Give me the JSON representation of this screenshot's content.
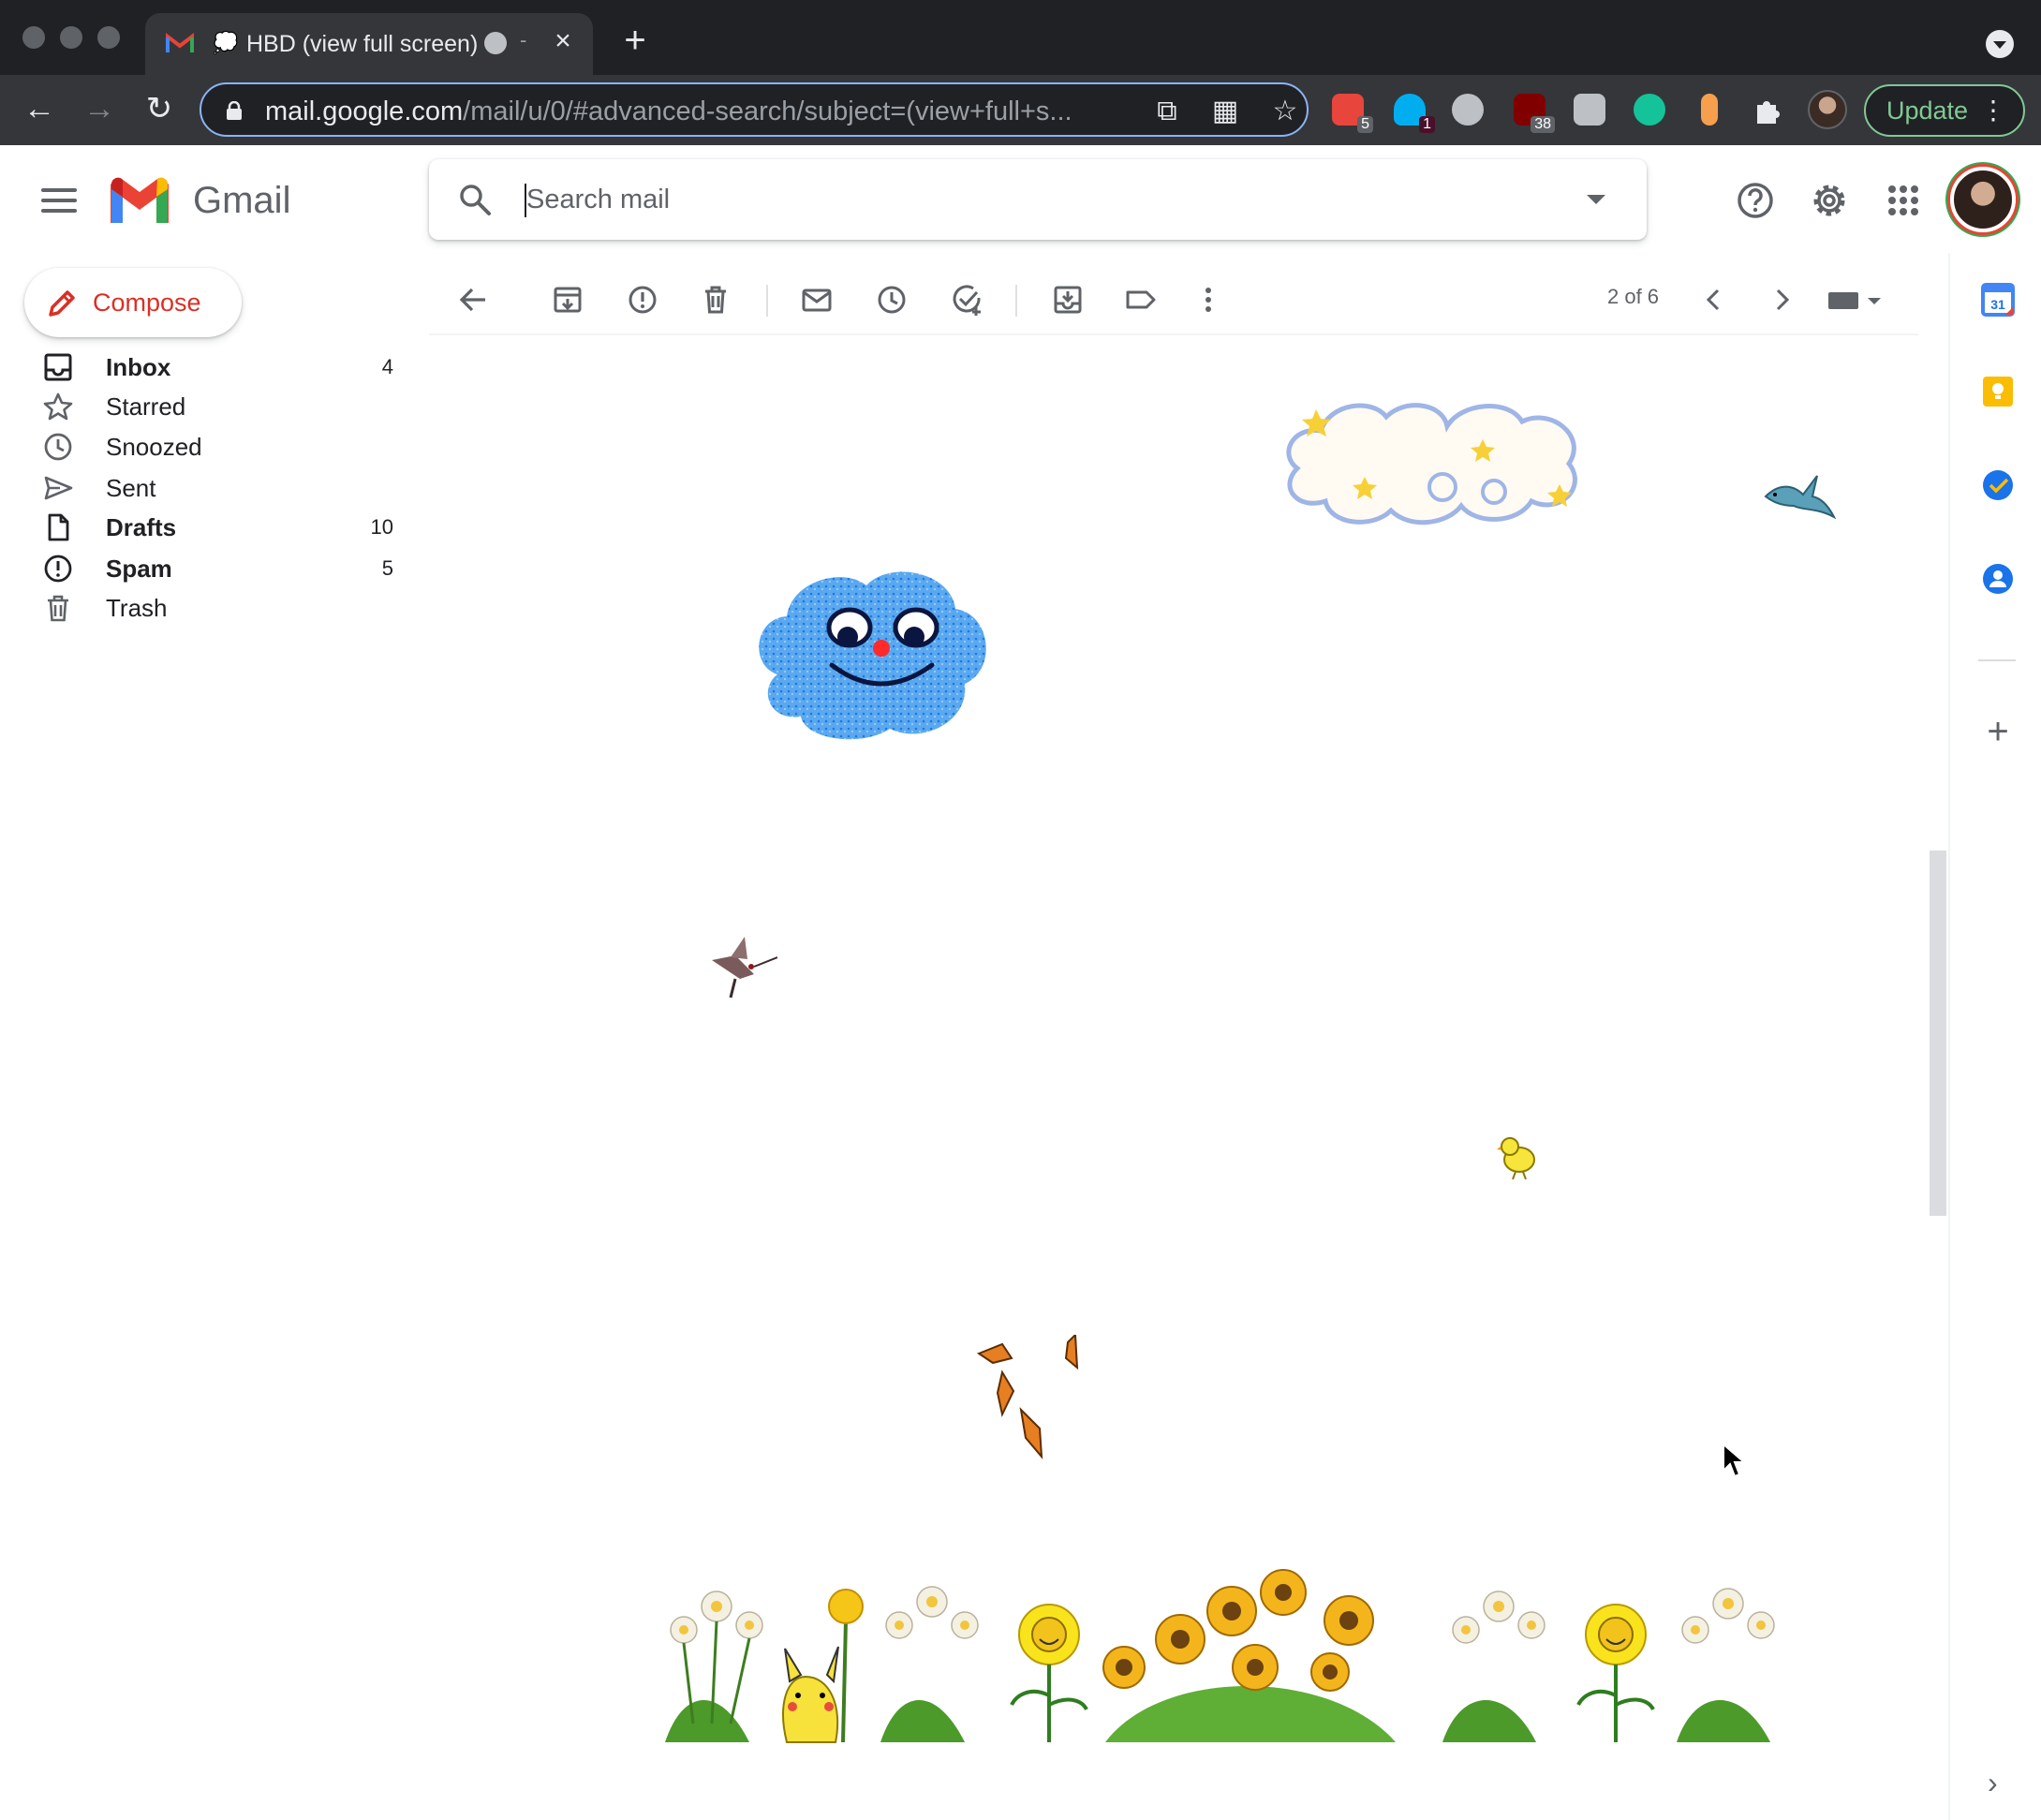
{
  "browser": {
    "tab": {
      "title": "HBD (view full screen)",
      "separator": "-",
      "close_symbol": "×"
    },
    "new_tab_symbol": "+",
    "url": {
      "domain": "mail.google.com",
      "path": "/mail/u/0/#advanced-search/subject=(view+full+s..."
    },
    "extensions": [
      {
        "name": "adblock-icon",
        "label": "ABP",
        "badge": "5",
        "color": "#e8453c"
      },
      {
        "name": "ghostery-icon",
        "badge": "1",
        "color": "#00aef0"
      },
      {
        "name": "pinterest-icon",
        "color": "#bdc1c6"
      },
      {
        "name": "ublock-icon",
        "label": "uO",
        "badge": "38",
        "color": "#800000"
      },
      {
        "name": "extension-k-icon",
        "color": "#bdc1c6"
      },
      {
        "name": "grammarly-icon",
        "color": "#15c39a"
      },
      {
        "name": "dropper-icon",
        "color": "#f6a04d"
      },
      {
        "name": "puzzle-icon",
        "color": "#e8eaed"
      }
    ],
    "update_label": "Update"
  },
  "gmail": {
    "app_name": "Gmail",
    "search": {
      "placeholder": "Search mail"
    },
    "compose_label": "Compose",
    "nav": [
      {
        "name": "inbox",
        "label": "Inbox",
        "count": "4",
        "bold": true
      },
      {
        "name": "starred",
        "label": "Starred",
        "count": "",
        "bold": false
      },
      {
        "name": "snoozed",
        "label": "Snoozed",
        "count": "",
        "bold": false
      },
      {
        "name": "sent",
        "label": "Sent",
        "count": "",
        "bold": false
      },
      {
        "name": "drafts",
        "label": "Drafts",
        "count": "10",
        "bold": true
      },
      {
        "name": "spam",
        "label": "Spam",
        "count": "5",
        "bold": true
      },
      {
        "name": "trash",
        "label": "Trash",
        "count": "",
        "bold": false
      }
    ],
    "pager": "2 of 6",
    "side_panel": [
      "calendar-icon",
      "keep-icon",
      "tasks-icon",
      "contacts-icon"
    ],
    "colors": {
      "red": "#ea4335",
      "blue": "#4285f4",
      "green": "#34a853",
      "yellow": "#fbbc04",
      "chrome_dark": "#202124",
      "chrome_toolbar": "#35363a"
    }
  },
  "email_art": [
    "smiling-blue-cloud",
    "white-cloud-with-stars",
    "blue-bird",
    "hummingbird",
    "yellow-chick",
    "butterflies",
    "daisies",
    "pikachu-with-dandelion",
    "smiling-sunflower",
    "sunflower-bunch"
  ]
}
